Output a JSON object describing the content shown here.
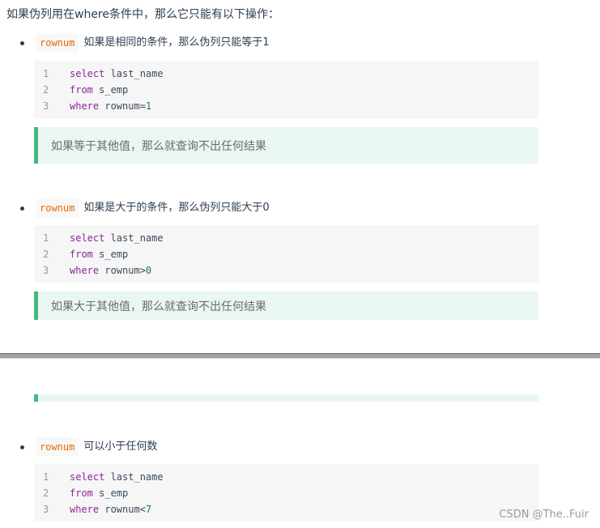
{
  "intro": "如果伪列用在where条件中，那么它只能有以下操作：",
  "sections": [
    {
      "code_tag": "rownum",
      "description": "如果是相同的条件，那么伪列只能等于1",
      "lines": [
        {
          "n": "1",
          "kw": "select",
          "rest": " last_name",
          "num": ""
        },
        {
          "n": "2",
          "kw": "from",
          "rest": " s_emp",
          "num": ""
        },
        {
          "n": "3",
          "kw": "where",
          "rest": " rownum=",
          "num": "1"
        }
      ],
      "tip": "如果等于其他值，那么就查询不出任何结果"
    },
    {
      "code_tag": "rownum",
      "description": "如果是大于的条件，那么伪列只能大于0",
      "lines": [
        {
          "n": "1",
          "kw": "select",
          "rest": " last_name",
          "num": ""
        },
        {
          "n": "2",
          "kw": "from",
          "rest": " s_emp",
          "num": ""
        },
        {
          "n": "3",
          "kw": "where",
          "rest": " rownum>",
          "num": "0"
        }
      ],
      "tip": "如果大于其他值，那么就查询不出任何结果"
    },
    {
      "code_tag": "rownum",
      "description": "可以小于任何数",
      "lines": [
        {
          "n": "1",
          "kw": "select",
          "rest": " last_name",
          "num": ""
        },
        {
          "n": "2",
          "kw": "from",
          "rest": " s_emp",
          "num": ""
        },
        {
          "n": "3",
          "kw": "where",
          "rest": " rownum<",
          "num": "7"
        }
      ]
    }
  ],
  "watermark": "CSDN @The..Fuir",
  "colors": {
    "accent": "#42b983",
    "inline_code": "#e96900",
    "keyword": "#8a2896",
    "tip_bg": "#eaf6f1"
  }
}
